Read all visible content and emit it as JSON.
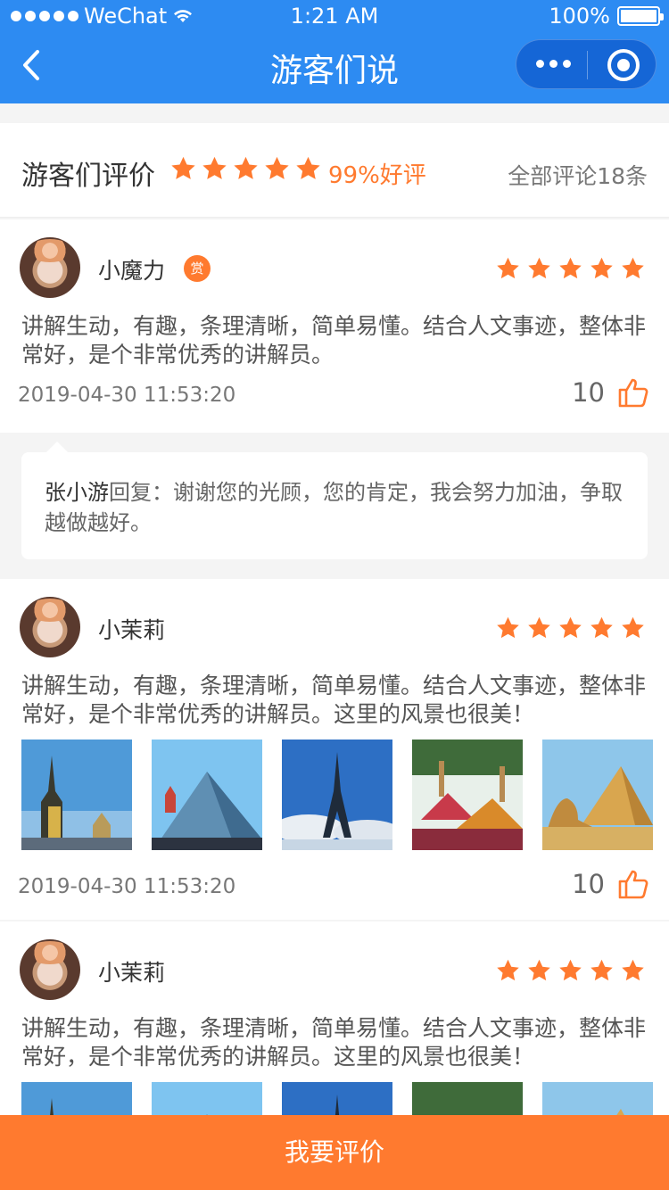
{
  "status": {
    "carrier": "WeChat",
    "time": "1:21 AM",
    "battery": "100%"
  },
  "nav": {
    "title": "游客们说"
  },
  "summary": {
    "label": "游客们评价",
    "rating_stars": 5,
    "positive_rate": "99%好评",
    "total": "全部评论18条"
  },
  "reviews": [
    {
      "name": "小魔力",
      "badge": "赏",
      "stars": 5,
      "text": "讲解生动，有趣，条理清晰，简单易懂。结合人文事迹，整体非常好，是个非常优秀的讲解员。",
      "date": "2019-04-30  11:53:20",
      "likes": "10"
    },
    {
      "name": "小茉莉",
      "stars": 5,
      "text": "讲解生动，有趣，条理清晰，简单易懂。结合人文事迹，整体非常好，是个非常优秀的讲解员。这里的风景也很美！",
      "date": "2019-04-30  11:53:20",
      "likes": "10"
    },
    {
      "name": "小茉莉",
      "stars": 5,
      "text": "讲解生动，有趣，条理清晰，简单易懂。结合人文事迹，整体非常好，是个非常优秀的讲解员。这里的风景也很美！"
    }
  ],
  "reply": {
    "author": "张小游",
    "prefix": "回复：",
    "text": "谢谢您的光顾，您的肯定，我会努力加油，争取越做越好。"
  },
  "photos": [
    "castle",
    "glass-pyramid",
    "eiffel-tower",
    "thai-temple",
    "egypt-pyramids"
  ],
  "footer": {
    "button": "我要评价"
  },
  "colors": {
    "primary": "#2d8bf2",
    "accent": "#ff7a2f"
  }
}
